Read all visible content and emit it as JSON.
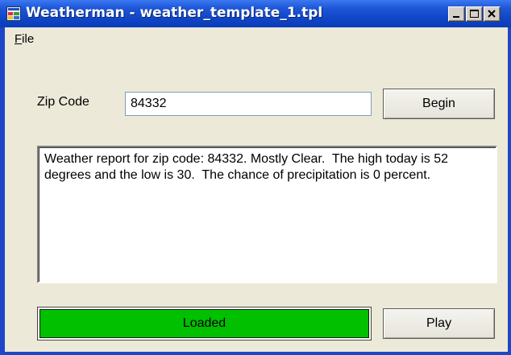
{
  "window": {
    "title": "Weatherman - weather_template_1.tpl",
    "icon": "app-window-icon",
    "caption_buttons": [
      "minimize-icon",
      "maximize-icon",
      "close-icon"
    ]
  },
  "menu": {
    "file_rest": "ile",
    "file_accel": "F"
  },
  "form": {
    "zip_label": "Zip Code",
    "zip_value": "84332",
    "begin_label": "Begin",
    "play_label": "Play"
  },
  "report": {
    "text": "Weather report for zip code: 84332. Mostly Clear.  The high today is 52 degrees and the low is 30.  The chance of precipitation is 0 percent."
  },
  "status": {
    "label": "Loaded",
    "progress": 1.0,
    "color": "#00c000"
  },
  "colors": {
    "titlebar": "#0f44c6",
    "window_bg": "#ece9d8",
    "status_fill": "#00c000"
  }
}
